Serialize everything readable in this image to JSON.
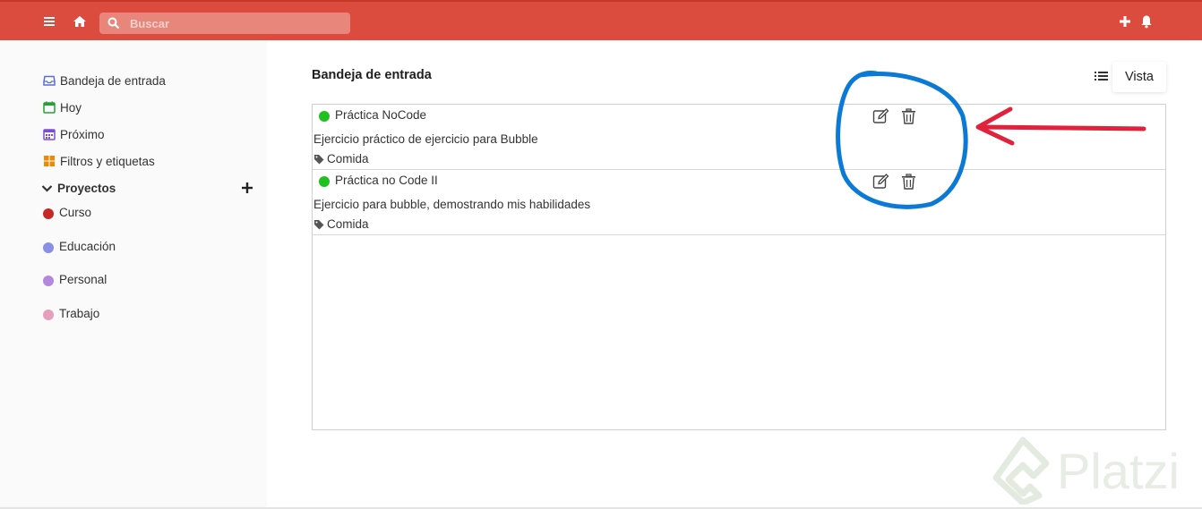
{
  "topbar": {
    "search_placeholder": "Buscar",
    "color": "#db4c3f"
  },
  "sidebar": {
    "items": [
      {
        "label": "Bandeja de entrada",
        "icon": "inbox-icon",
        "color": "#5b6fd0"
      },
      {
        "label": "Hoy",
        "icon": "calendar-today-icon",
        "color": "#2a9d3a"
      },
      {
        "label": "Próximo",
        "icon": "calendar-upcoming-icon",
        "color": "#7b4ecf"
      },
      {
        "label": "Filtros y etiquetas",
        "icon": "filters-icon",
        "color": "#eb8909"
      }
    ],
    "projects_label": "Proyectos",
    "projects": [
      {
        "label": "Curso",
        "color": "#c62828"
      },
      {
        "label": "Educación",
        "color": "#8a8fe6"
      },
      {
        "label": "Personal",
        "color": "#b389e0"
      },
      {
        "label": "Trabajo",
        "color": "#e59ebd"
      }
    ]
  },
  "main": {
    "title": "Bandeja de entrada",
    "view_label": "Vista",
    "tasks": [
      {
        "title": "Práctica NoCode",
        "description": "Ejercicio práctico de ejercicio para Bubble",
        "tag": "Comida"
      },
      {
        "title": "Práctica no Code II",
        "description": "Ejercicio para bubble, demostrando mis habilidades",
        "tag": "Comida"
      }
    ]
  },
  "watermark": {
    "text": "Platzi"
  },
  "annotation": {
    "circle_color": "#0a7ad6",
    "arrow_color": "#e0223b"
  }
}
